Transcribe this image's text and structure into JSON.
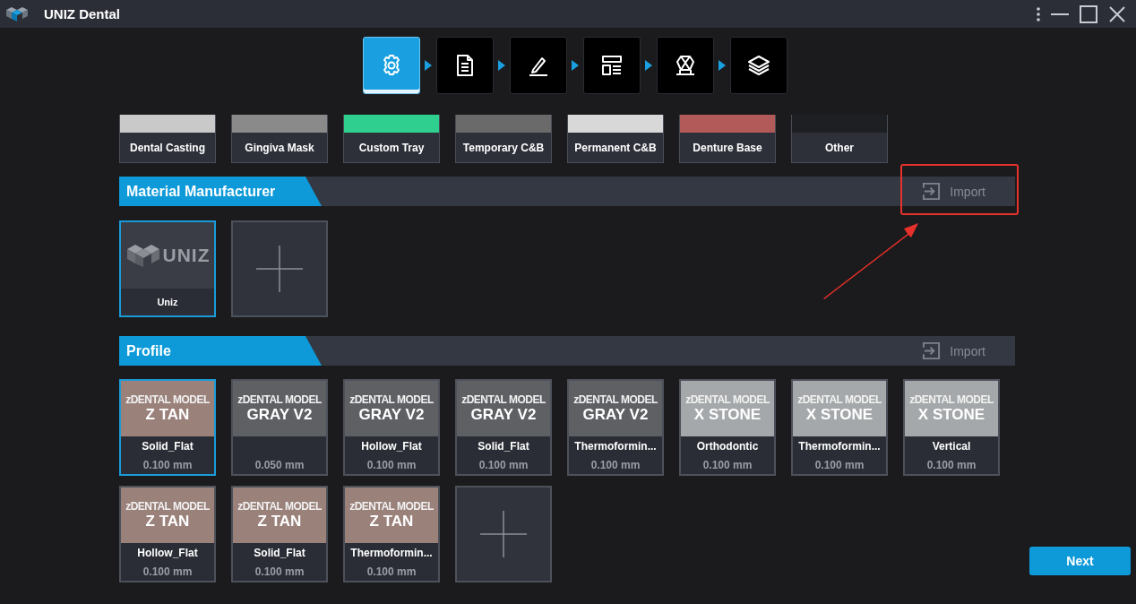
{
  "window": {
    "title": "UNIZ Dental"
  },
  "steps": [
    {
      "kind": "settings",
      "selected": true
    },
    {
      "kind": "document",
      "selected": false
    },
    {
      "kind": "edit",
      "selected": false
    },
    {
      "kind": "layout",
      "selected": false
    },
    {
      "kind": "model",
      "selected": false
    },
    {
      "kind": "layers",
      "selected": false
    }
  ],
  "categories": [
    {
      "label": "Dental Casting",
      "color": "#c9c9c9"
    },
    {
      "label": "Gingiva Mask",
      "color": "#8a8a8a"
    },
    {
      "label": "Custom Tray",
      "color": "#2fd08f"
    },
    {
      "label": "Temporary C&B",
      "color": "#6a6a6a"
    },
    {
      "label": "Permanent C&B",
      "color": "#d8d8d8"
    },
    {
      "label": "Denture Base",
      "color": "#b25a5a"
    },
    {
      "label": "Other",
      "color": "#1e1f23"
    }
  ],
  "manufacturer_section": {
    "title": "Material Manufacturer",
    "import_label": "Import",
    "highlighted": true
  },
  "manufacturers": [
    {
      "logo_text": "UNIZ",
      "label": "Uniz",
      "selected": true
    }
  ],
  "profile_section": {
    "title": "Profile",
    "import_label": "Import",
    "highlighted": false
  },
  "profiles": [
    {
      "brand": "zDENTAL MODEL",
      "material": "Z TAN",
      "color": "#9a817a",
      "name": "Solid_Flat",
      "thickness": "0.100 mm",
      "selected": true
    },
    {
      "brand": "zDENTAL MODEL",
      "material": "GRAY V2",
      "color": "#5e6064",
      "thickness": "0.050 mm",
      "selected": false
    },
    {
      "brand": "zDENTAL MODEL",
      "material": "GRAY V2",
      "color": "#5e6064",
      "name": "Hollow_Flat",
      "thickness": "0.100 mm",
      "selected": false
    },
    {
      "brand": "zDENTAL MODEL",
      "material": "GRAY V2",
      "color": "#5e6064",
      "name": "Solid_Flat",
      "thickness": "0.100 mm",
      "selected": false
    },
    {
      "brand": "zDENTAL MODEL",
      "material": "GRAY V2",
      "color": "#5e6064",
      "name": "Thermoformin...",
      "thickness": "0.100 mm",
      "selected": false
    },
    {
      "brand": "zDENTAL MODEL",
      "material": "X STONE",
      "color": "#a5a8aa",
      "name": "Orthodontic",
      "thickness": "0.100 mm",
      "selected": false
    },
    {
      "brand": "zDENTAL MODEL",
      "material": "X STONE",
      "color": "#a5a8aa",
      "name": "Thermoformin...",
      "thickness": "0.100 mm",
      "selected": false
    },
    {
      "brand": "zDENTAL MODEL",
      "material": "X STONE",
      "color": "#a5a8aa",
      "name": "Vertical",
      "thickness": "0.100 mm",
      "selected": false
    },
    {
      "brand": "zDENTAL MODEL",
      "material": "Z TAN",
      "color": "#9a817a",
      "name": "Hollow_Flat",
      "thickness": "0.100 mm",
      "selected": false
    },
    {
      "brand": "zDENTAL MODEL",
      "material": "Z TAN",
      "color": "#9a817a",
      "name": "Solid_Flat",
      "thickness": "0.100 mm",
      "selected": false
    },
    {
      "brand": "zDENTAL MODEL",
      "material": "Z TAN",
      "color": "#9a817a",
      "name": "Thermoformin...",
      "thickness": "0.100 mm",
      "selected": false
    }
  ],
  "next_button": "Next"
}
